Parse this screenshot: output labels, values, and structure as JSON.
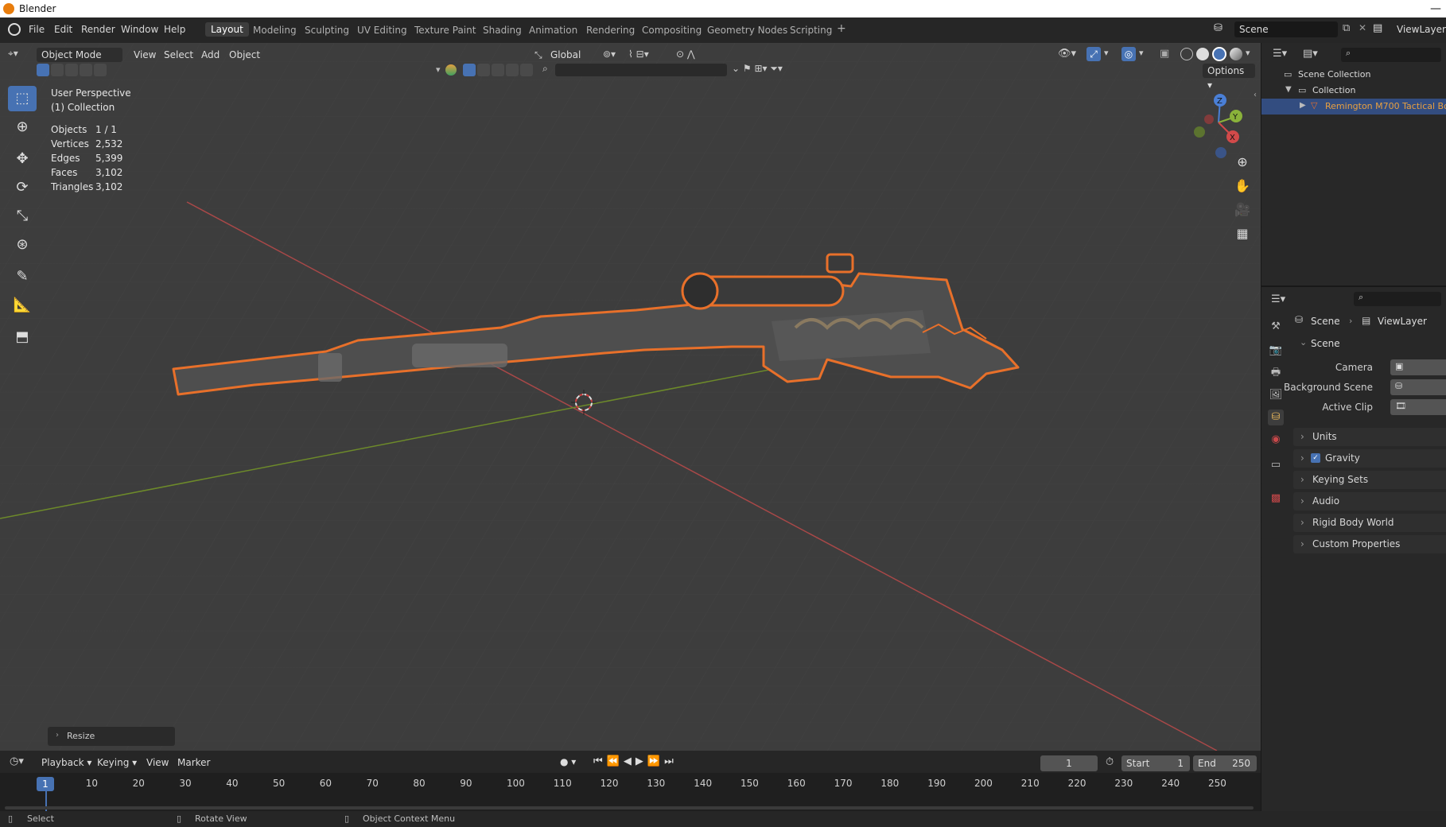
{
  "app": {
    "title": "Blender"
  },
  "menus": [
    "File",
    "Edit",
    "Render",
    "Window",
    "Help"
  ],
  "workspaces": [
    "Layout",
    "Modeling",
    "Sculpting",
    "UV Editing",
    "Texture Paint",
    "Shading",
    "Animation",
    "Rendering",
    "Compositing",
    "Geometry Nodes",
    "Scripting"
  ],
  "active_workspace": "Layout",
  "scene_field": "Scene",
  "viewlayer_field": "ViewLayer",
  "viewport": {
    "mode": "Object Mode",
    "menus": [
      "View",
      "Select",
      "Add",
      "Object"
    ],
    "transform_orientation": "Global",
    "options_label": "Options",
    "view_name": "User Perspective",
    "collection_name": "(1) Collection",
    "stats": [
      {
        "label": "Objects",
        "value": "1 / 1"
      },
      {
        "label": "Vertices",
        "value": "2,532"
      },
      {
        "label": "Edges",
        "value": "5,399"
      },
      {
        "label": "Faces",
        "value": "3,102"
      },
      {
        "label": "Triangles",
        "value": "3,102"
      }
    ],
    "last_operator": "Resize",
    "gizmo_axes": {
      "x": "X",
      "y": "Y",
      "z": "Z"
    }
  },
  "timeline": {
    "menus": [
      "Playback",
      "Keying",
      "View",
      "Marker"
    ],
    "current_frame": "1",
    "start_label": "Start",
    "start_value": "1",
    "end_label": "End",
    "end_value": "250",
    "ruler": [
      "10",
      "20",
      "30",
      "40",
      "50",
      "60",
      "70",
      "80",
      "90",
      "100",
      "110",
      "120",
      "130",
      "140",
      "150",
      "160",
      "170",
      "180",
      "190",
      "200",
      "210",
      "220",
      "230",
      "240",
      "250"
    ]
  },
  "status": {
    "select": "Select",
    "rotate": "Rotate View",
    "context": "Object Context Menu"
  },
  "outliner": {
    "scene_collection": "Scene Collection",
    "collection": "Collection",
    "object": "Remington M700 Tactical Bo"
  },
  "properties": {
    "breadcrumb_scene": "Scene",
    "breadcrumb_viewlayer": "ViewLayer",
    "section": "Scene",
    "fields": {
      "camera": "Camera",
      "background_scene": "Background Scene",
      "active_clip": "Active Clip"
    },
    "panels": [
      "Units",
      "Gravity",
      "Keying Sets",
      "Audio",
      "Rigid Body World",
      "Custom Properties"
    ],
    "gravity_enabled": true
  },
  "colors": {
    "accent_blue": "#4772b3",
    "selection_orange": "#e8702a",
    "axis_red": "#c74a4a",
    "axis_green": "#7a9a2a"
  }
}
